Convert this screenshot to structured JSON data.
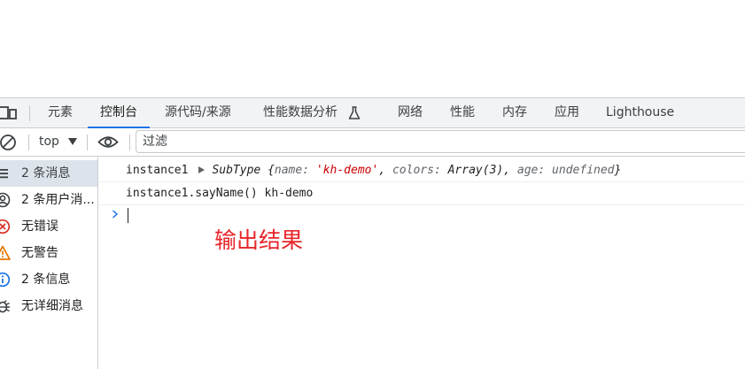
{
  "tabs": [
    {
      "label": "元素",
      "active": false
    },
    {
      "label": "控制台",
      "active": true
    },
    {
      "label": "源代码/来源",
      "active": false
    },
    {
      "label": "性能数据分析",
      "active": false
    },
    {
      "label": "网络",
      "active": false
    },
    {
      "label": "性能",
      "active": false
    },
    {
      "label": "内存",
      "active": false
    },
    {
      "label": "应用",
      "active": false
    },
    {
      "label": "Lighthouse",
      "active": false
    }
  ],
  "toolbar": {
    "context": "top",
    "filter_placeholder": "过滤"
  },
  "sidebar": {
    "items": [
      {
        "label": "2 条消息",
        "icon": "list-icon",
        "selected": true
      },
      {
        "label": "2 条用户消...",
        "icon": "user-icon",
        "selected": false
      },
      {
        "label": "无错误",
        "icon": "error-icon",
        "selected": false
      },
      {
        "label": "无警告",
        "icon": "warning-icon",
        "selected": false
      },
      {
        "label": "2 条信息",
        "icon": "info-icon",
        "selected": false
      },
      {
        "label": "无详细消息",
        "icon": "bug-icon",
        "selected": false
      }
    ]
  },
  "console": {
    "row1": {
      "prefix": "instance1",
      "type": "SubType",
      "open": "{",
      "k1": "name",
      "v1": "'kh-demo'",
      "k2": "colors",
      "v2": "Array(3)",
      "k3": "age",
      "v3": "undefined",
      "close": "}"
    },
    "row2": {
      "call": "instance1.sayName()",
      "output": "kh-demo"
    }
  },
  "annotation": "输出结果",
  "colors": {
    "accent": "#1a73e8",
    "error": "#d93025",
    "warning": "#e37400",
    "annotation": "#e8262a",
    "string": "#c80000"
  }
}
